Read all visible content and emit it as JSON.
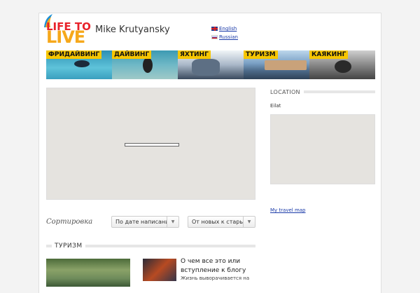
{
  "header": {
    "logo": {
      "line1": "LIFE TO",
      "line2": "LIVE"
    },
    "site_title": "Mike Krutyansky",
    "languages": [
      {
        "label": "English",
        "flag": "uk-flag-icon"
      },
      {
        "label": "Russian",
        "flag": "ru-flag-icon"
      }
    ]
  },
  "banner": {
    "tiles": [
      {
        "label": "ФРИДАЙВИНГ"
      },
      {
        "label": "ДАЙВИНГ"
      },
      {
        "label": "ЯХТИНГ"
      },
      {
        "label": "ТУРИЗМ"
      },
      {
        "label": "КАЯКИНГ"
      }
    ]
  },
  "main": {
    "sort_label": "Сортировка",
    "sort_by": {
      "selected": "По дате написания"
    },
    "sort_order": {
      "selected": "От новых к старым"
    },
    "section_title": "ТУРИЗМ",
    "post": {
      "title": "О чем все это или вступление к блогу",
      "excerpt": "Жизнь выворачивается на"
    }
  },
  "sidebar": {
    "location_title": "LOCATION",
    "location_value": "Eilat",
    "travel_map_link": "My travel map"
  },
  "colors": {
    "accent_yellow": "#f7c600",
    "logo_red": "#e8222a",
    "logo_orange": "#f6a81b",
    "link_blue": "#1a3aa8"
  }
}
